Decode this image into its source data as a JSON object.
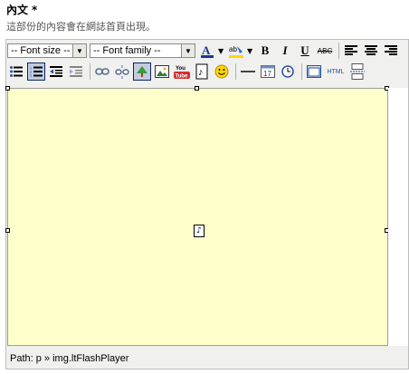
{
  "field": {
    "label": "內文",
    "required_mark": "*",
    "hint": "這部份的內容會在網誌首頁出現。"
  },
  "toolbar": {
    "font_size": "-- Font size --",
    "font_family": "-- Font family --",
    "bold": "B",
    "italic": "I",
    "underline": "U",
    "strikethrough": "ABC",
    "youtube": "You Tube",
    "html_label": "HTML"
  },
  "status_bar": {
    "path": "Path: p » img.ltFlashPlayer"
  }
}
